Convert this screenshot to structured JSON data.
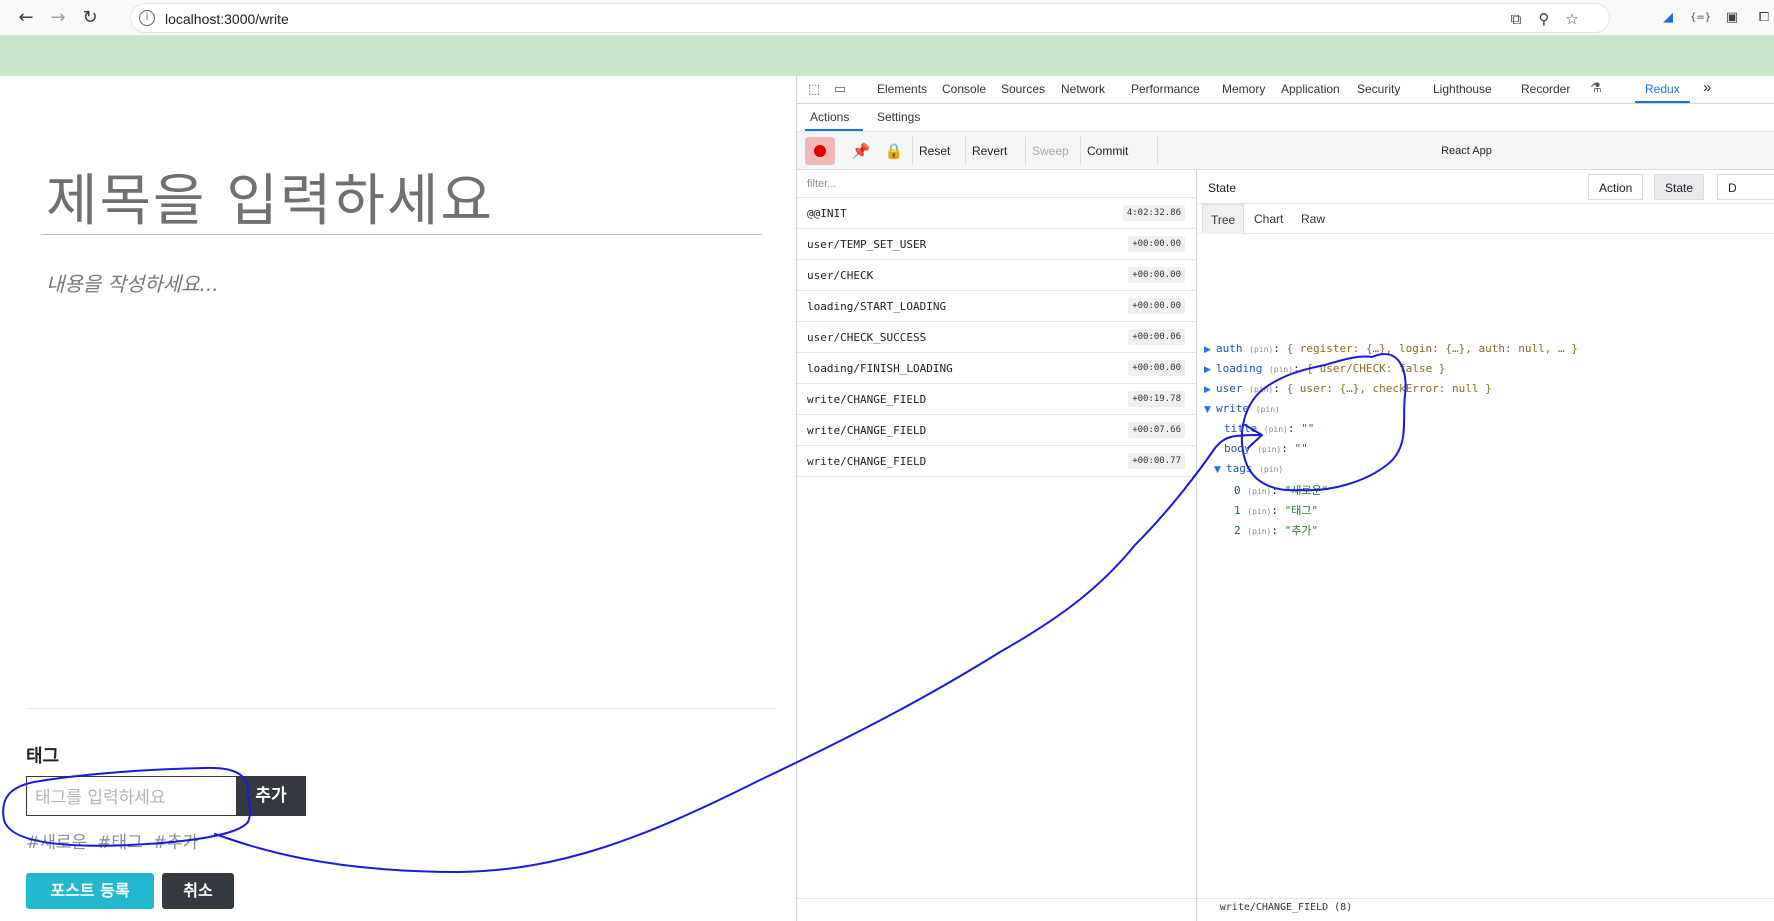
{
  "browser": {
    "nav": {
      "back": "←",
      "forward": "→",
      "reload": "↻"
    },
    "url": "localhost:3000/write",
    "omnibox_icons": [
      "open-in-window-icon",
      "zoom-icon",
      "bookmark-star-icon"
    ],
    "extension_icons": [
      "extension-a-icon",
      "extension-b-icon",
      "profile-icon",
      "puzzle-icon"
    ]
  },
  "editor": {
    "title_placeholder": "제목을 입력하세요",
    "body_placeholder": "내용을 작성하세요...",
    "tags_heading": "태그",
    "tag_input_placeholder": "태그를 입력하세요",
    "tag_add_label": "추가",
    "tags": [
      "#새로운",
      "#태그",
      "#추가"
    ],
    "post_button": "포스트 등록",
    "cancel_button": "취소"
  },
  "devtools": {
    "tabs": [
      "Elements",
      "Console",
      "Sources",
      "Network",
      "Performance",
      "Memory",
      "Application",
      "Security",
      "Lighthouse",
      "Recorder",
      "Redux"
    ],
    "active_tab": "Redux",
    "more": "»",
    "redux_subtabs": [
      "Actions",
      "Settings"
    ],
    "toolbar": {
      "reset": "Reset",
      "revert": "Revert",
      "sweep": "Sweep",
      "commit": "Commit",
      "instance": "React App"
    },
    "filter_placeholder": "filter...",
    "actions": [
      {
        "name": "@@INIT",
        "time": "4:02:32.86"
      },
      {
        "name": "user/TEMP_SET_USER",
        "time": "+00:00.00"
      },
      {
        "name": "user/CHECK",
        "time": "+00:00.00"
      },
      {
        "name": "loading/START_LOADING",
        "time": "+00:00.00"
      },
      {
        "name": "user/CHECK_SUCCESS",
        "time": "+00:00.06"
      },
      {
        "name": "loading/FINISH_LOADING",
        "time": "+00:00.00"
      },
      {
        "name": "write/CHANGE_FIELD",
        "time": "+00:19.78"
      },
      {
        "name": "write/CHANGE_FIELD",
        "time": "+00:07.66"
      },
      {
        "name": "write/CHANGE_FIELD",
        "time": "+00:00.77"
      }
    ],
    "state": {
      "label": "State",
      "modes": [
        "Action",
        "State",
        "D"
      ],
      "active_mode": "State",
      "views": [
        "Tree",
        "Chart",
        "Raw"
      ],
      "active_view": "Tree",
      "pin": "(pin)",
      "rows": {
        "auth_key": "auth",
        "auth_val": "{ register: {…}, login: {…}, auth: null, … }",
        "loading_key": "loading",
        "loading_val": "{ user/CHECK: false }",
        "user_key": "user",
        "user_val": "{ user: {…}, checkError: null }",
        "write_key": "write",
        "title_key": "title",
        "title_val": "\"\"",
        "body_key": "body",
        "body_val": "\"\"",
        "tags_key": "tags",
        "tag0_key": "0",
        "tag0_val": "\"새로운\"",
        "tag1_key": "1",
        "tag1_val": "\"태그\"",
        "tag2_key": "2",
        "tag2_val": "\"추가\""
      }
    },
    "footer": "write/CHANGE_FIELD (8)"
  },
  "colors": {
    "chrome_bg": "#c8e6c9",
    "accent": "#1a73e8",
    "post_button": "#22b8cf",
    "dark_button": "#343a40",
    "annotation": "#1a1adb"
  }
}
